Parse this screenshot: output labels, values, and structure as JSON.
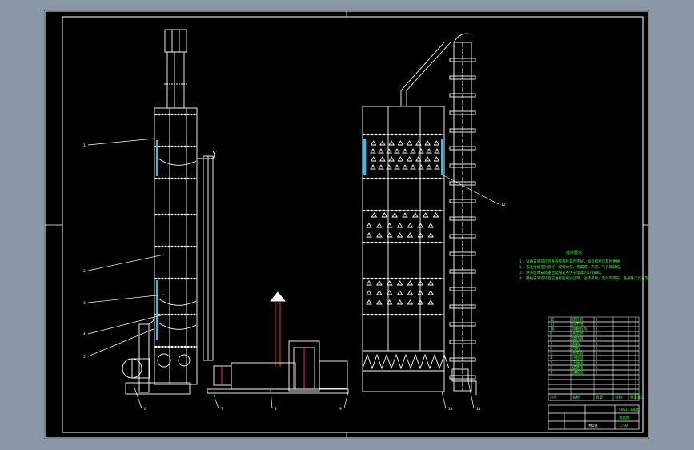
{
  "drawing": {
    "callouts": [
      "1",
      "2",
      "3",
      "4",
      "5",
      "6",
      "7",
      "8",
      "9",
      "10",
      "11",
      "12"
    ],
    "notes_title": "技术要求",
    "notes": [
      "1. 设备安装前应检查各零部件是否完好，如有损坏应及时更换。",
      "2. 各连接处密封良好，焊缝均匀，无漏焊、夹渣、气孔等缺陷。",
      "3. 烘干塔体安装垂直度偏差不大于塔高的1/1000。",
      "4. 整机安装完毕后应进行空载试运转，运转平稳，无异常噪声，各部件工作正常。"
    ],
    "parts_rows": [
      [
        "12",
        "提升机",
        "1",
        "",
        "",
        ""
      ],
      [
        "11",
        "烘干塔",
        "1",
        "",
        "",
        ""
      ],
      [
        "10",
        "排粮机构",
        "1",
        "",
        "",
        ""
      ],
      [
        "9",
        "热风炉",
        "1",
        "",
        "",
        ""
      ],
      [
        "8",
        "换热器",
        "1",
        "",
        "",
        ""
      ],
      [
        "7",
        "烟囱",
        "1",
        "",
        "",
        ""
      ],
      [
        "6",
        "风机",
        "1",
        "",
        "",
        ""
      ],
      [
        "5",
        "热风管",
        "1",
        "",
        "",
        ""
      ],
      [
        "4",
        "冷却段",
        "1",
        "",
        "",
        ""
      ],
      [
        "3",
        "干燥段",
        "1",
        "",
        "",
        ""
      ],
      [
        "2",
        "缓苏段",
        "1",
        "",
        "",
        ""
      ],
      [
        "1",
        "储粮段",
        "1",
        "",
        "",
        ""
      ],
      [
        "",
        "",
        "",
        "",
        "",
        ""
      ],
      [
        "",
        "",
        "",
        "",
        "",
        ""
      ],
      [
        "",
        "",
        "",
        "",
        "",
        ""
      ],
      [
        "",
        "",
        "",
        "",
        "",
        ""
      ]
    ],
    "parts_header": [
      "序号",
      "名称",
      "数量",
      "材料",
      "重量",
      "备注"
    ],
    "title_block": {
      "name": "5HSZ-300型",
      "drawing_no": "总装图",
      "scale": "1:50",
      "sheet": "共1张"
    }
  }
}
